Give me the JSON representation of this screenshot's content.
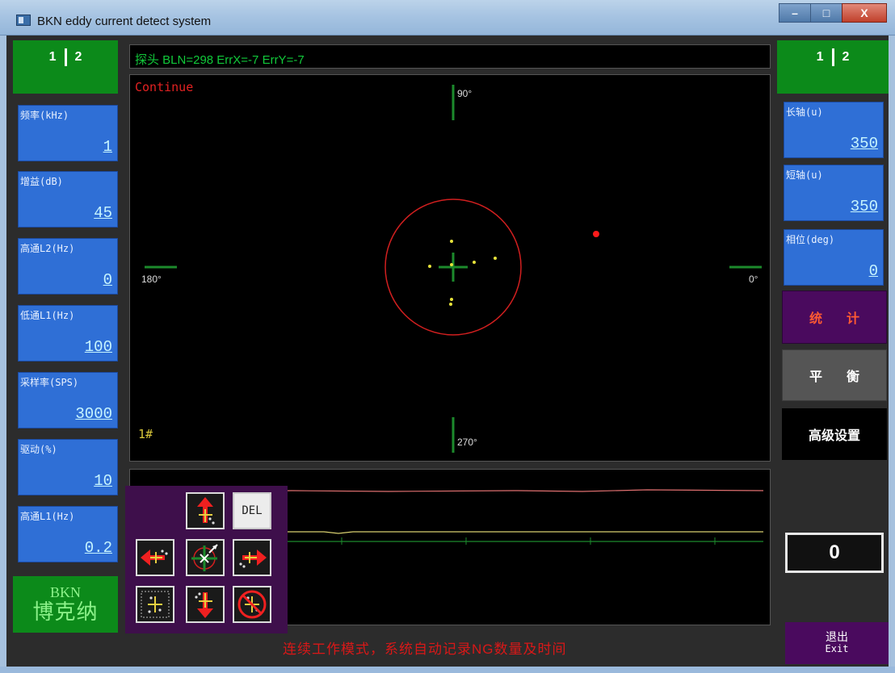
{
  "window": {
    "title": "BKN eddy current detect system",
    "min_symbol": "–",
    "max_symbol": "□",
    "close_symbol": "X"
  },
  "left_tabs": [
    "1",
    "2"
  ],
  "right_tabs": [
    "1",
    "2"
  ],
  "left_params": [
    {
      "label": "频率(kHz)",
      "value": "1"
    },
    {
      "label": "增益(dB)",
      "value": "45"
    },
    {
      "label": "高通L2(Hz)",
      "value": "0"
    },
    {
      "label": "低通L1(Hz)",
      "value": "100"
    },
    {
      "label": "采样率(SPS)",
      "value": "3000"
    },
    {
      "label": "驱动(%)",
      "value": "10"
    },
    {
      "label": "高通L1(Hz)",
      "value": "0.2"
    }
  ],
  "right_params": [
    {
      "label": "长轴(u)",
      "value": "350"
    },
    {
      "label": "短轴(u)",
      "value": "350"
    },
    {
      "label": "相位(deg)",
      "value": "0"
    }
  ],
  "logo": {
    "line1": "BKN",
    "line2": "博克纳"
  },
  "infobar": "探头 BLN=298 ErrX=-7 ErrY=-7",
  "scope": {
    "mode": "Continue",
    "channel": "1#",
    "angles": {
      "top": "90°",
      "bottom": "270°",
      "left": "180°",
      "right": "0°"
    }
  },
  "toolbox": {
    "del_label": "DEL"
  },
  "buttons": {
    "stat": [
      "统",
      "计"
    ],
    "balance": [
      "平",
      "衡"
    ],
    "advanced": "高级设置",
    "exit_cn": "退出",
    "exit_en": "Exit"
  },
  "counter": "0",
  "status_message": "连续工作模式，系统自动记录NG数量及时间",
  "colors": {
    "panel_blue": "#2f6fd6",
    "tab_green": "#0c8a1a",
    "purple": "#4a0a5e",
    "alarm_circle": "#d11f1f",
    "trace_red": "#e07070",
    "trace_yellow": "#d8d070",
    "trace_green": "#1c8a2c"
  }
}
